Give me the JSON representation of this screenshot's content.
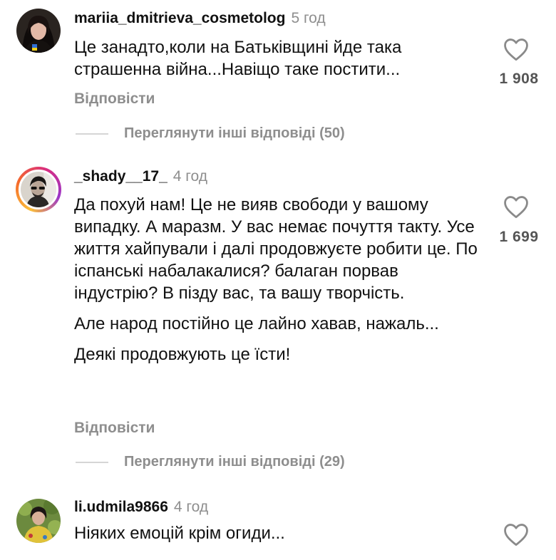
{
  "comments": [
    {
      "username": "mariia_dmitrieva_cosmetolog",
      "time": "5 год",
      "paragraphs": [
        "Це занадто,коли на Батьківщині йде така страшенна війна...Навіщо таке постити..."
      ],
      "likes": "1 908",
      "reply_label": "Відповісти",
      "more_replies": "Переглянути інші відповіді (50)"
    },
    {
      "username": "_shady__17_",
      "time": "4 год",
      "paragraphs": [
        "Да похуй нам! Це не вияв свободи у вашому випадку. А маразм. У вас немає почуття такту. Усе життя хайпували і далі продовжуєте робити це. По іспанські набалакалися? балаган порвав індустрію? В пізду вас, та вашу творчість.",
        "Але народ постійно це лайно хавав, нажаль...",
        "Деякі продовжують це їсти!"
      ],
      "likes": "1 699",
      "reply_label": "Відповісти",
      "more_replies": "Переглянути інші відповіді (29)"
    },
    {
      "username": "li.udmila9866",
      "time": "4 год",
      "paragraphs": [
        "Ніяких емоцій крім огиди..."
      ]
    }
  ],
  "icons": {
    "like": "heart-outline-icon"
  },
  "colors": {
    "username": "#111111",
    "meta": "#8e8e8e",
    "divider": "#d5d5d5",
    "ring_start": "#fbbf3b",
    "ring_end": "#9b35c9"
  }
}
